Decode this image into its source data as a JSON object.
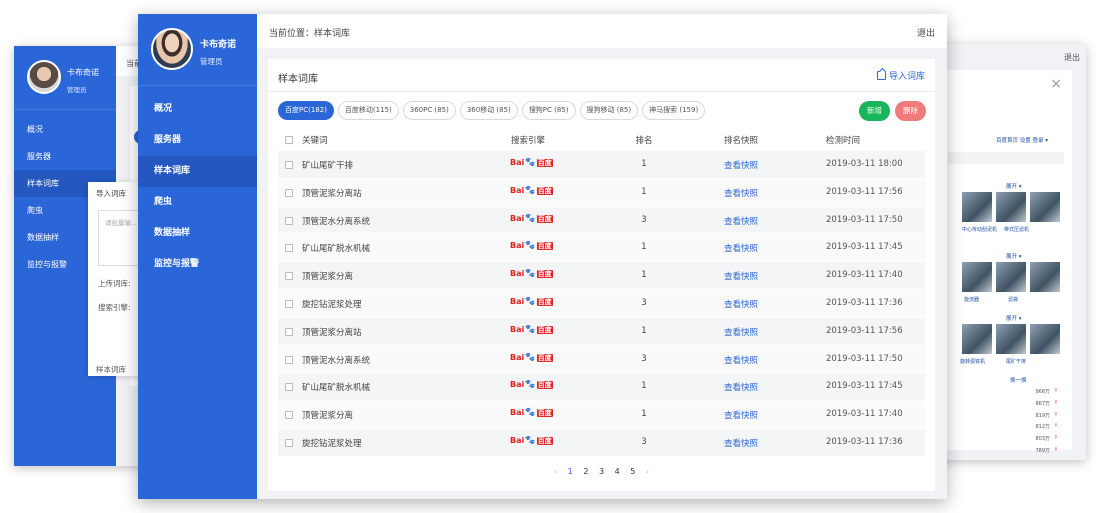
{
  "back_left": {
    "user_name": "卡布奇诺",
    "user_role": "管理员",
    "nav": [
      "概况",
      "服务器",
      "样本词库",
      "爬虫",
      "数据抽样",
      "监控与报警"
    ],
    "top_text": "当前",
    "modal_title": "导入词库",
    "modal_placeholder": "请批量输...",
    "modal_upload_label": "上传词库:",
    "modal_engine_label": "搜索引擎:",
    "modal_footer": "样本词库"
  },
  "back_right": {
    "logout": "退出",
    "links": "百度首页  设置  登录 ▾",
    "more": "展开 ▾",
    "captions_1": [
      "中心传动刮泥机",
      "带式压滤机"
    ],
    "captions_2": [
      "旋流器",
      "滤袋"
    ],
    "captions_3": [
      "旋转弧铁机",
      "尾矿干排"
    ],
    "refresh": "换一换",
    "hot_values": [
      "966万",
      "867万",
      "819万",
      "812万",
      "803万",
      "789万"
    ]
  },
  "sidebar": {
    "user_name": "卡布奇诺",
    "user_role": "管理员",
    "items": [
      {
        "label": "概况",
        "active": false
      },
      {
        "label": "服务器",
        "active": false
      },
      {
        "label": "样本词库",
        "active": true
      },
      {
        "label": "爬虫",
        "active": false
      },
      {
        "label": "数据抽样",
        "active": false
      },
      {
        "label": "监控与报警",
        "active": false
      }
    ]
  },
  "header": {
    "breadcrumb": "当前位置：样本词库",
    "logout": "退出"
  },
  "content": {
    "title": "样本词库",
    "import_label": "导入词库",
    "tabs": [
      "百度PC(182)",
      "百度移动(115)",
      "360PC (85)",
      "360移动 (85)",
      "搜狗PC (85)",
      "搜狗移动 (85)",
      "神马搜索 (159)"
    ],
    "active_tab": 0,
    "add_label": "新增",
    "delete_label": "删除"
  },
  "table": {
    "columns": [
      "关键词",
      "搜索引擎",
      "排名",
      "排名快照",
      "检测时间"
    ],
    "engine_logo_text": "Bai百度",
    "rows": [
      {
        "keyword": "矿山尾矿干排",
        "rank": "1",
        "snapshot": "查看快照",
        "time": "2019-03-11 18:00"
      },
      {
        "keyword": "顶管泥浆分离站",
        "rank": "1",
        "snapshot": "查看快照",
        "time": "2019-03-11 17:56"
      },
      {
        "keyword": "顶管泥水分离系统",
        "rank": "3",
        "snapshot": "查看快照",
        "time": "2019-03-11 17:50"
      },
      {
        "keyword": "矿山尾矿脱水机械",
        "rank": "1",
        "snapshot": "查看快照",
        "time": "2019-03-11 17:45"
      },
      {
        "keyword": "顶管泥浆分离",
        "rank": "1",
        "snapshot": "查看快照",
        "time": "2019-03-11 17:40"
      },
      {
        "keyword": "旋挖钻泥浆处理",
        "rank": "3",
        "snapshot": "查看快照",
        "time": "2019-03-11 17:36"
      },
      {
        "keyword": "顶管泥浆分离站",
        "rank": "1",
        "snapshot": "查看快照",
        "time": "2019-03-11 17:56"
      },
      {
        "keyword": "顶管泥水分离系统",
        "rank": "3",
        "snapshot": "查看快照",
        "time": "2019-03-11 17:50"
      },
      {
        "keyword": "矿山尾矿脱水机械",
        "rank": "1",
        "snapshot": "查看快照",
        "time": "2019-03-11 17:45"
      },
      {
        "keyword": "顶管泥浆分离",
        "rank": "1",
        "snapshot": "查看快照",
        "time": "2019-03-11 17:40"
      },
      {
        "keyword": "旋挖钻泥浆处理",
        "rank": "3",
        "snapshot": "查看快照",
        "time": "2019-03-11 17:36"
      }
    ]
  },
  "pagination": {
    "prev": "‹",
    "pages": [
      "1",
      "2",
      "3",
      "4",
      "5"
    ],
    "current": "1",
    "next": "›"
  },
  "colors": {
    "sidebar": "#2b66d9",
    "sidebar_active": "#2458c0",
    "add": "#19b55c",
    "delete": "#f07b7b",
    "link": "#2b66d9"
  }
}
